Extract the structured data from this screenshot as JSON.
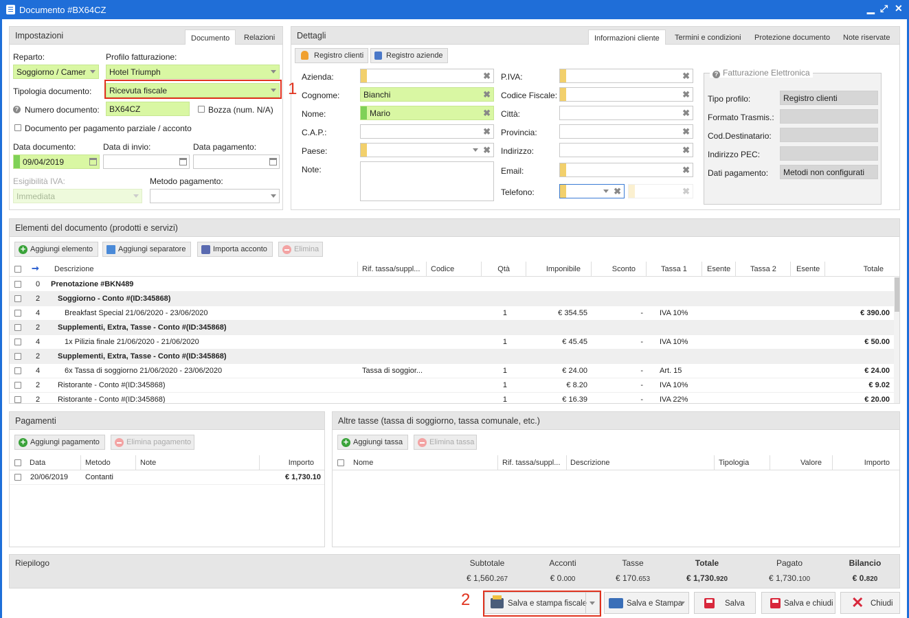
{
  "window": {
    "title": "Documento #BX64CZ",
    "minimize": "▁",
    "maximize": "⤢",
    "close": "✕"
  },
  "impostazioni": {
    "title": "Impostazioni",
    "tabs": [
      "Documento",
      "Relazioni"
    ],
    "reparto_label": "Reparto:",
    "reparto_value": "Soggiorno / Camer",
    "profilo_label": "Profilo fatturazione:",
    "profilo_value": "Hotel Triumph",
    "tipologia_label": "Tipologia documento:",
    "tipologia_value": "Ricevuta fiscale",
    "numero_label": "Numero documento:",
    "numero_value": "BX64CZ",
    "bozza_label": "Bozza (num. N/A)",
    "parziale_label": "Documento per pagamento parziale / acconto",
    "data_doc_label": "Data documento:",
    "data_doc_value": "09/04/2019",
    "data_invio_label": "Data di invio:",
    "data_pag_label": "Data pagamento:",
    "esig_label": "Esigibilità IVA:",
    "esig_value": "Immediata",
    "metodo_label": "Metodo pagamento:"
  },
  "dettagli": {
    "title": "Dettagli",
    "tabs": [
      "Informazioni cliente",
      "Termini e condizioni",
      "Protezione documento",
      "Note riservate"
    ],
    "btn_registro_clienti": "Registro clienti",
    "btn_registro_aziende": "Registro aziende",
    "azienda_label": "Azienda:",
    "cognome_label": "Cognome:",
    "cognome_value": "Bianchi",
    "nome_label": "Nome:",
    "nome_value": "Mario",
    "cap_label": "C.A.P.:",
    "paese_label": "Paese:",
    "note_label": "Note:",
    "piva_label": "P.IVA:",
    "cf_label": "Codice Fiscale:",
    "citta_label": "Città:",
    "provincia_label": "Provincia:",
    "indirizzo_label": "Indirizzo:",
    "email_label": "Email:",
    "telefono_label": "Telefono:",
    "fe_title": "Fatturazione Elettronica",
    "tipo_profilo_label": "Tipo profilo:",
    "tipo_profilo_value": "Registro clienti",
    "formato_label": "Formato Trasmis.:",
    "coddest_label": "Cod.Destinatario:",
    "pec_label": "Indirizzo PEC:",
    "datipag_label": "Dati pagamento:",
    "datipag_value": "Metodi non configurati"
  },
  "elementi": {
    "title": "Elementi del documento (prodotti e servizi)",
    "buttons": [
      "Aggiungi elemento",
      "Aggiungi separatore",
      "Importa acconto",
      "Elimina"
    ],
    "columns": [
      "Descrizione",
      "Rif. tassa/suppl...",
      "Codice",
      "Qtà",
      "Imponibile",
      "Sconto",
      "Tassa 1",
      "Esente",
      "Tassa 2",
      "Esente",
      "Totale"
    ],
    "rows": [
      {
        "lvl": "0",
        "desc": "Prenotazione #BKN489",
        "rif": "",
        "qta": "",
        "imp": "",
        "sconto": "",
        "tassa": "",
        "tot": "",
        "style": "top"
      },
      {
        "lvl": "2",
        "desc": "Soggiorno - Conto #(ID:345868)",
        "rif": "",
        "qta": "",
        "imp": "",
        "sconto": "",
        "tassa": "",
        "tot": "",
        "style": "grp"
      },
      {
        "lvl": "4",
        "desc": "Breakfast Special 21/06/2020 - 23/06/2020",
        "rif": "",
        "qta": "1",
        "imp": "€ 354.55",
        "sconto": "-",
        "tassa": "IVA 10%",
        "tot": "€ 390.00",
        "style": "item"
      },
      {
        "lvl": "2",
        "desc": "Supplementi, Extra, Tasse - Conto #(ID:345868)",
        "rif": "",
        "qta": "",
        "imp": "",
        "sconto": "",
        "tassa": "",
        "tot": "",
        "style": "grp"
      },
      {
        "lvl": "4",
        "desc": "1x Pilizia finale 21/06/2020 - 21/06/2020",
        "rif": "",
        "qta": "1",
        "imp": "€ 45.45",
        "sconto": "-",
        "tassa": "IVA 10%",
        "tot": "€ 50.00",
        "style": "item"
      },
      {
        "lvl": "2",
        "desc": "Supplementi, Extra, Tasse - Conto #(ID:345868)",
        "rif": "",
        "qta": "",
        "imp": "",
        "sconto": "",
        "tassa": "",
        "tot": "",
        "style": "grp"
      },
      {
        "lvl": "4",
        "desc": "6x Tassa di soggiorno 21/06/2020 - 23/06/2020",
        "rif": "Tassa di soggior...",
        "qta": "1",
        "imp": "€ 24.00",
        "sconto": "-",
        "tassa": "Art. 15",
        "tot": "€ 24.00",
        "style": "item"
      },
      {
        "lvl": "2",
        "desc": "Ristorante - Conto #(ID:345868)",
        "rif": "",
        "qta": "1",
        "imp": "€ 8.20",
        "sconto": "-",
        "tassa": "IVA 10%",
        "tot": "€ 9.02",
        "style": "plain"
      },
      {
        "lvl": "2",
        "desc": "Ristorante - Conto #(ID:345868)",
        "rif": "",
        "qta": "1",
        "imp": "€ 16.39",
        "sconto": "-",
        "tassa": "IVA 22%",
        "tot": "€ 20.00",
        "style": "plain"
      }
    ]
  },
  "pagamenti": {
    "title": "Pagamenti",
    "btn_add": "Aggiungi pagamento",
    "btn_del": "Elimina pagamento",
    "columns": [
      "Data",
      "Metodo",
      "Note",
      "Importo"
    ],
    "rows": [
      {
        "data": "20/06/2019",
        "metodo": "Contanti",
        "note": "",
        "importo": "€ 1,730.10"
      }
    ]
  },
  "altre_tasse": {
    "title": "Altre tasse (tassa di soggiorno, tassa comunale, etc.)",
    "btn_add": "Aggiungi tassa",
    "btn_del": "Elimina tassa",
    "columns": [
      "Nome",
      "Rif. tassa/suppl...",
      "Descrizione",
      "Tipologia",
      "Valore",
      "Importo"
    ]
  },
  "riepilogo": {
    "title": "Riepilogo",
    "cols": [
      {
        "label": "Subtotale",
        "main": "€ 1,560.",
        "small": "267",
        "bold": false
      },
      {
        "label": "Acconti",
        "main": "€ 0.",
        "small": "000",
        "bold": false
      },
      {
        "label": "Tasse",
        "main": "€ 170.",
        "small": "653",
        "bold": false
      },
      {
        "label": "Totale",
        "main": "€ 1,730.",
        "small": "920",
        "bold": true
      },
      {
        "label": "Pagato",
        "main": "€ 1,730.",
        "small": "100",
        "bold": false
      },
      {
        "label": "Bilancio",
        "main": "€ 0.",
        "small": "820",
        "bold": true
      }
    ]
  },
  "actions": {
    "salva_stampa_fiscale": "Salva e stampa fiscale",
    "salva_stampa": "Salva e Stampa",
    "salva": "Salva",
    "salva_chiudi": "Salva e chiudi",
    "chiudi": "Chiudi"
  },
  "annotations": {
    "one": "1",
    "two": "2"
  }
}
